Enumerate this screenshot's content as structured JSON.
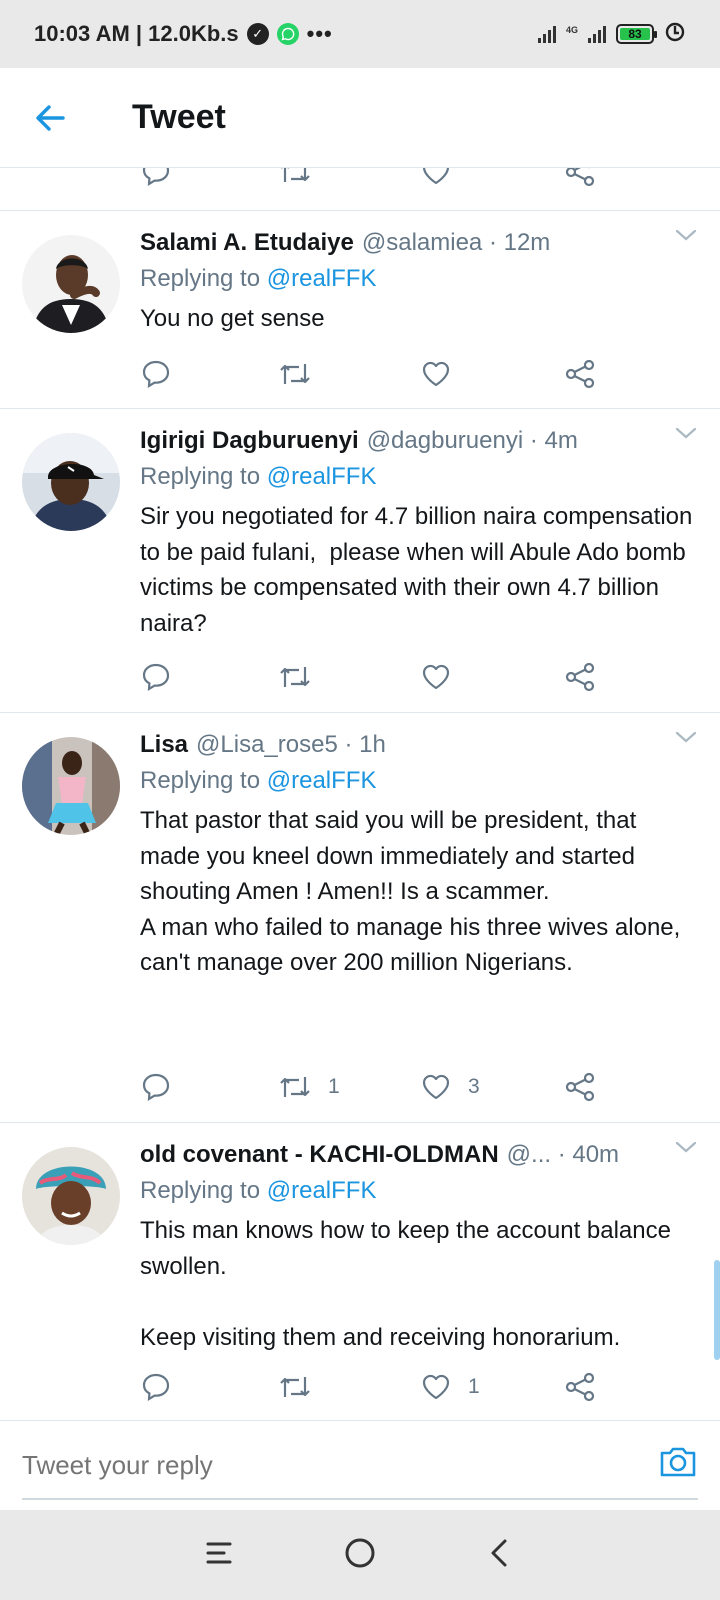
{
  "status_bar": {
    "time_speed": "10:03 AM | 12.0Kb.s",
    "network_label": "4G",
    "battery": "83"
  },
  "header": {
    "title": "Tweet"
  },
  "tweets": [
    {
      "name": "Salami A. Etudaiye",
      "handle": "@salamiea · 12m",
      "replying_prefix": "Replying to ",
      "replying_to": "@realFFK",
      "text": "You no get sense",
      "retweets": "",
      "likes": ""
    },
    {
      "name": "Igirigi Dagburuenyi",
      "handle": "@dagburuenyi · 4m",
      "replying_prefix": "Replying to ",
      "replying_to": "@realFFK",
      "text": "Sir you negotiated for 4.7 billion naira compensation to be paid fulani,  please when will Abule Ado bomb victims be compensated with their own 4.7 billion naira?",
      "retweets": "",
      "likes": ""
    },
    {
      "name": "Lisa",
      "handle": "@Lisa_rose5 · 1h",
      "replying_prefix": "Replying to ",
      "replying_to": "@realFFK",
      "text": "That pastor that said you will be president, that made you kneel down immediately and started shouting Amen ! Amen!! Is a scammer.\nA man who failed to manage his three wives alone, can't manage over 200 million Nigerians.",
      "retweets": "1",
      "likes": "3"
    },
    {
      "name": "old covenant - KACHI-OLDMAN",
      "handle": "@... · 40m",
      "replying_prefix": "Replying to ",
      "replying_to": "@realFFK",
      "text": "This man knows how to keep the account balance swollen.\n\nKeep visiting them and receiving honorarium.",
      "retweets": "",
      "likes": "1"
    }
  ],
  "reply_box": {
    "placeholder": "Tweet your reply"
  },
  "icons": {
    "back": "arrow-left-icon",
    "reply": "speech-bubble-icon",
    "retweet": "retweet-icon",
    "like": "heart-icon",
    "share": "share-icon",
    "more": "chevron-down-icon",
    "camera": "camera-icon"
  },
  "colors": {
    "accent": "#1b95e0",
    "secondary_text": "#657786",
    "status_bar_bg": "#e9e9e9"
  }
}
